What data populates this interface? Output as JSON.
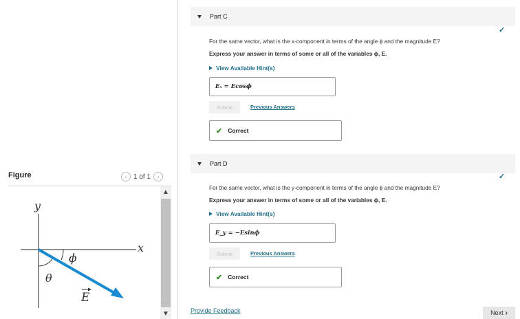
{
  "figure": {
    "title": "Figure",
    "pager": "1 of 1",
    "labels": {
      "y": "y",
      "x": "x",
      "phi": "ϕ",
      "theta": "θ",
      "vector": "E"
    }
  },
  "parts": [
    {
      "label": "Part C",
      "question": "For the same vector, what is the x-component in terms of the angle ϕ and the magnitude E?",
      "instruction": "Express your answer in terms of some or all of the variables ϕ, E.",
      "hint": "View Available Hint(s)",
      "answer": "Eₓ = Ecosϕ",
      "submit": "Submit",
      "previous": "Previous Answers",
      "status": "Correct"
    },
    {
      "label": "Part D",
      "question": "For the same vector, what is the y-component in terms of the angle ϕ and the magnitude E?",
      "instruction": "Express your answer in terms of some or all of the variables ϕ, E.",
      "hint": "View Available Hint(s)",
      "answer": "E_y = −Esinϕ",
      "submit": "Submit",
      "previous": "Previous Answers",
      "status": "Correct"
    }
  ],
  "footer": {
    "feedback": "Provide Feedback",
    "next": "Next"
  },
  "colors": {
    "accent": "#1f6f8b",
    "success": "#3c8d2f",
    "vector": "#1a8bd1"
  }
}
